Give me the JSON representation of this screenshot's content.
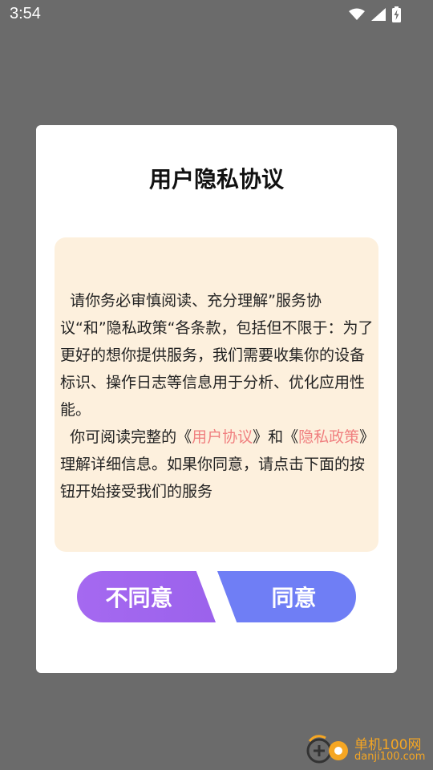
{
  "status_bar": {
    "time": "3:54",
    "icons": [
      "wifi-icon",
      "signal-icon",
      "battery-charging-icon"
    ]
  },
  "dialog": {
    "title": "用户隐私协议",
    "paragraph1": "  请你务必审慎阅读、充分理解”服务协议“和”隐私政策“各条款，包括但不限于：为了更好的想你提供服务，我们需要收集你的设备标识、操作日志等信息用于分析、优化应用性能。",
    "paragraph2_before": "  你可阅读完整的《",
    "link_user_agreement": "用户协议",
    "paragraph2_middle": "》和《",
    "link_privacy_policy": "隐私政策",
    "paragraph2_after": "》理解详细信息。如果你同意，请点击下面的按钮开始接受我们的服务"
  },
  "buttons": {
    "disagree_label": "不同意",
    "agree_label": "同意"
  },
  "watermark": {
    "name": "单机100网",
    "url": "danji100.com"
  },
  "colors": {
    "backdrop": "#6b6b6b",
    "content_bg": "#fdf0dd",
    "link": "#f08080",
    "disagree_button": "#a569f0",
    "agree_button": "#6f7ef5",
    "watermark": "#f5a623"
  }
}
